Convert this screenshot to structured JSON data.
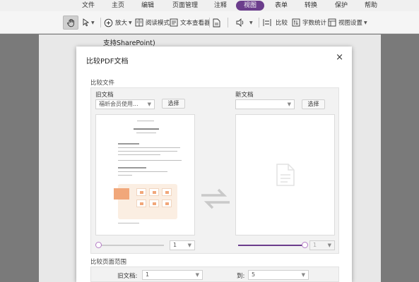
{
  "menu": {
    "items": [
      "文件",
      "主页",
      "编辑",
      "页面管理",
      "注释",
      "视图",
      "表单",
      "转换",
      "保护",
      "帮助"
    ],
    "active": "视图"
  },
  "toolbar": {
    "zoom_label": "放大",
    "read_mode_label": "阅读模式",
    "text_viewer_label": "文本查看器",
    "compare_label": "比较",
    "word_count_label": "字数统计",
    "view_settings_label": "视图设置"
  },
  "document": {
    "visible_text": "支持SharePoint)"
  },
  "dialog": {
    "title": "比较PDF文档",
    "close_glyph": "×",
    "compare_files_label": "比较文件",
    "old_doc": {
      "label": "旧文档",
      "file_value": "福昕会员使用...",
      "choose_label": "选择",
      "page_value": "1"
    },
    "new_doc": {
      "label": "新文档",
      "file_value": "",
      "choose_label": "选择",
      "page_value": "1"
    },
    "range_section_label": "比较页面范围",
    "old_range": {
      "label": "旧文档:",
      "value": "1"
    },
    "new_range": {
      "label": "到:",
      "value": "5"
    }
  },
  "colors": {
    "accent": "#6b3d8c",
    "slider_thumb": "#b57cc7"
  },
  "icons": [
    "hand-icon",
    "select-arrow-icon",
    "zoom-in-icon",
    "read-mode-icon",
    "text-viewer-icon",
    "document-icon",
    "audio-icon",
    "compare-icon",
    "word-count-icon",
    "view-settings-icon",
    "close-icon",
    "swap-arrows-icon",
    "empty-document-icon"
  ]
}
